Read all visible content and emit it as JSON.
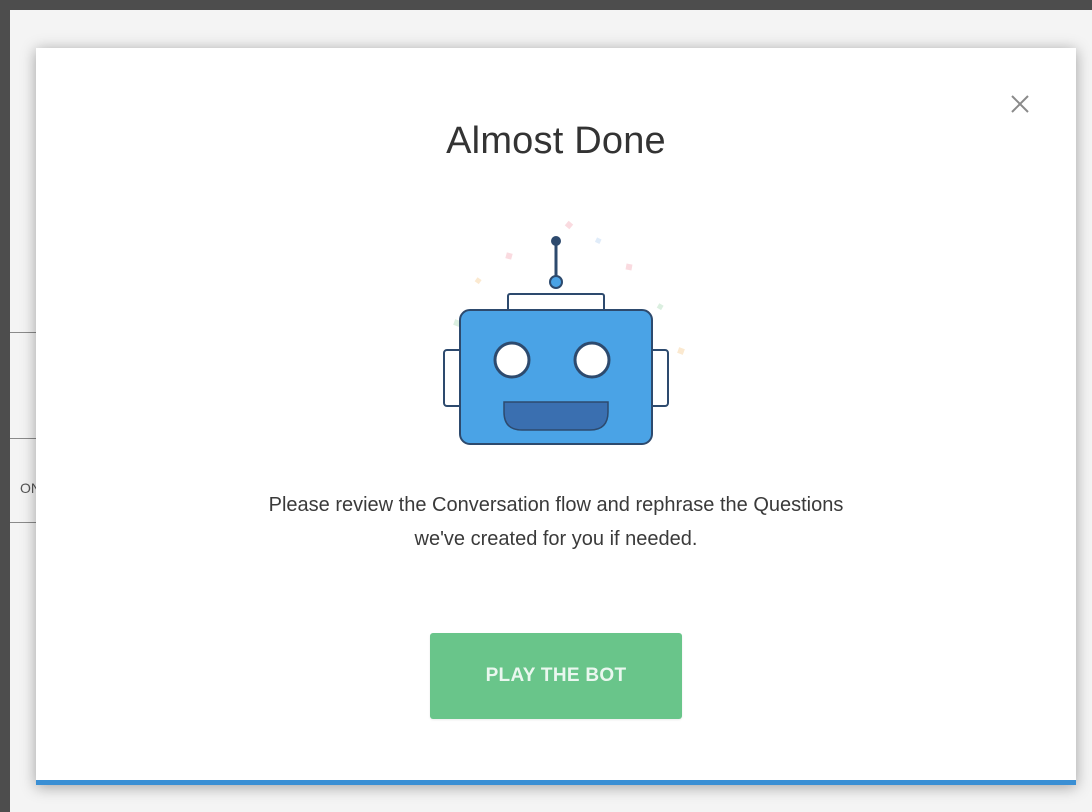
{
  "modal": {
    "title": "Almost Done",
    "message_line1": "Please review the Conversation flow and rephrase the Questions",
    "message_line2": "we've created for you if needed.",
    "primary_button": "PLAY THE BOT",
    "close_icon": "close-icon",
    "illustration": "robot-icon"
  },
  "background": {
    "tab_fragment": "ON"
  },
  "colors": {
    "overlay": "#4d4d4d",
    "modal_bg": "#ffffff",
    "accent_border": "#3a8fd4",
    "button_green": "#69c58a",
    "robot_blue": "#4aa3e6",
    "robot_mouth": "#3a6fb0"
  }
}
